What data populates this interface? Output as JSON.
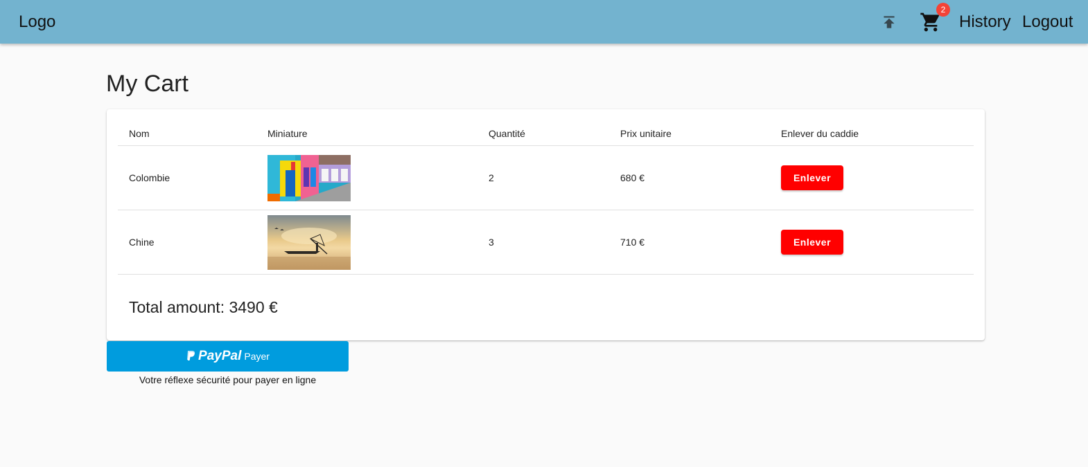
{
  "header": {
    "logo": "Logo",
    "icons": {
      "upload": "upload-icon",
      "cart": "cart-icon"
    },
    "cart_badge": "2",
    "history_label": "History",
    "logout_label": "Logout",
    "bar_color": "#73b3cf",
    "badge_color": "#f44336"
  },
  "page": {
    "title": "My Cart"
  },
  "cart_table": {
    "headers": {
      "nom": "Nom",
      "miniature": "Miniature",
      "quantite": "Quantité",
      "prix": "Prix unitaire",
      "enlever": "Enlever du caddie"
    },
    "rows": [
      {
        "nom": "Colombie",
        "miniature_alt": "Colombie",
        "quantite": "2",
        "prix": "680 €",
        "remove_label": "Enlever"
      },
      {
        "nom": "Chine",
        "miniature_alt": "Chine",
        "quantite": "3",
        "prix": "710 €",
        "remove_label": "Enlever"
      }
    ],
    "remove_color": "#ff0000"
  },
  "total": {
    "text": "Total amount: 3490 €"
  },
  "paypal": {
    "brand": "PayPal",
    "label": "Payer",
    "tagline": "Votre réflexe sécurité pour payer en ligne",
    "color": "#009cde"
  }
}
